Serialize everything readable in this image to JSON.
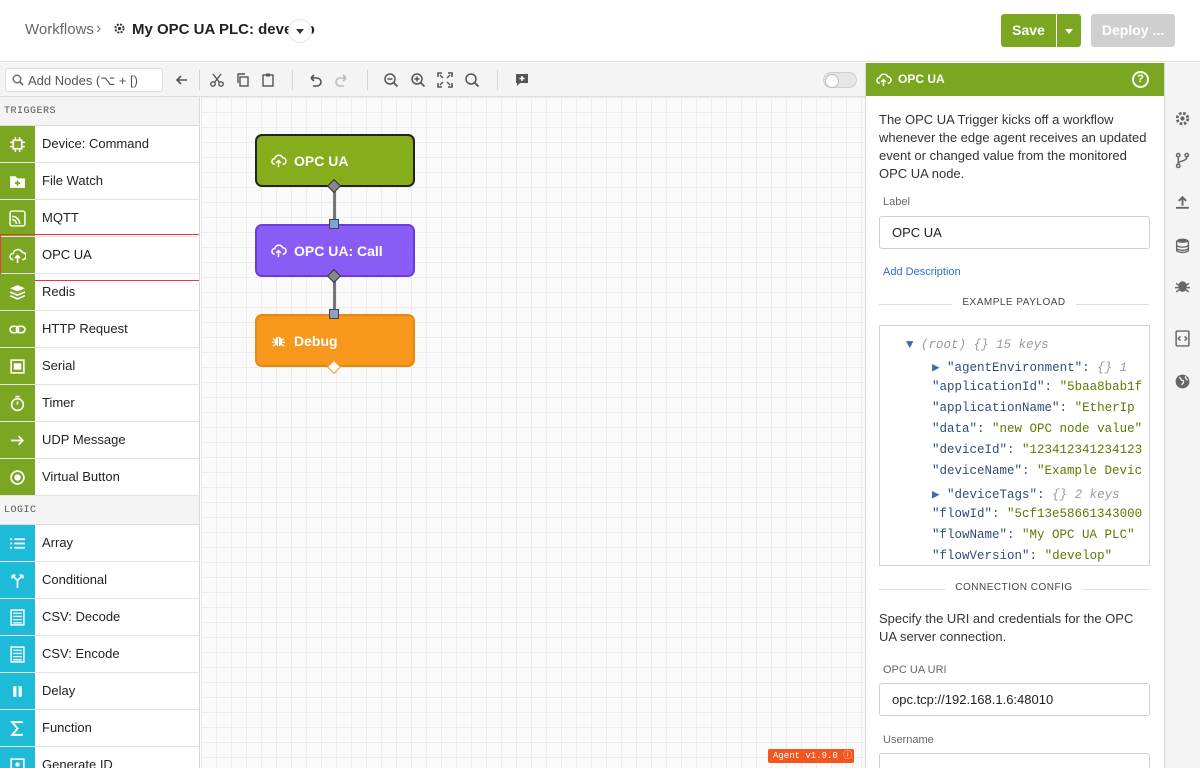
{
  "header": {
    "breadcrumb": "Workflows",
    "separator": "›",
    "flow_title": "My OPC UA PLC: develop",
    "save_label": "Save",
    "deploy_label": "Deploy ..."
  },
  "toolbar": {
    "search_placeholder": "Add Nodes (⌥ + [)"
  },
  "sidebar": {
    "triggers_heading": "TRIGGERS",
    "triggers": [
      {
        "label": "Device: Command",
        "icon": "chip-icon"
      },
      {
        "label": "File Watch",
        "icon": "folder-plus-icon"
      },
      {
        "label": "MQTT",
        "icon": "mqtt-icon"
      },
      {
        "label": "OPC UA",
        "icon": "cloud-upload-icon"
      },
      {
        "label": "Redis",
        "icon": "redis-layers-icon"
      },
      {
        "label": "HTTP Request",
        "icon": "link-icon"
      },
      {
        "label": "Serial",
        "icon": "serial-icon"
      },
      {
        "label": "Timer",
        "icon": "stopwatch-icon"
      },
      {
        "label": "UDP Message",
        "icon": "arrow-right-icon"
      },
      {
        "label": "Virtual Button",
        "icon": "radio-button-icon"
      }
    ],
    "logic_heading": "LOGIC",
    "logic": [
      {
        "label": "Array",
        "icon": "list-icon"
      },
      {
        "label": "Conditional",
        "icon": "branch-icon"
      },
      {
        "label": "CSV: Decode",
        "icon": "csv-icon"
      },
      {
        "label": "CSV: Encode",
        "icon": "csv-icon"
      },
      {
        "label": "Delay",
        "icon": "pause-icon"
      },
      {
        "label": "Function",
        "icon": "sigma-icon"
      },
      {
        "label": "Generate ID",
        "icon": "id-icon"
      }
    ]
  },
  "canvas": {
    "nodes": [
      {
        "label": "OPC UA",
        "color": "#86ad1c"
      },
      {
        "label": "OPC UA: Call",
        "color": "#8a5cf6"
      },
      {
        "label": "Debug",
        "color": "#f7981d"
      }
    ],
    "agent_badge": "Agent v1.9.0"
  },
  "panel": {
    "title": "OPC UA",
    "help": "?",
    "description": "The OPC UA Trigger kicks off a workflow whenever the edge agent receives an updated event or changed value from the monitored OPC UA node.",
    "label_caption": "Label",
    "label_value": "OPC UA",
    "add_description": "Add Description",
    "example_payload_heading": "EXAMPLE PAYLOAD",
    "payload": {
      "root": "(root)",
      "root_type": "{}",
      "root_count": "15 keys",
      "rows": [
        {
          "key": "\"agentEnvironment\"",
          "sep": ":",
          "value": "{}  1",
          "kind": "comment",
          "expandable": true
        },
        {
          "key": "\"applicationId\"",
          "sep": ":",
          "value": "\"5baa8bab1f",
          "kind": "string"
        },
        {
          "key": "\"applicationName\"",
          "sep": ":",
          "value": "\"EtherIp",
          "kind": "string"
        },
        {
          "key": "\"data\"",
          "sep": ":",
          "value": "\"new OPC node value\"",
          "kind": "string"
        },
        {
          "key": "\"deviceId\"",
          "sep": ":",
          "value": "\"123412341234123",
          "kind": "string"
        },
        {
          "key": "\"deviceName\"",
          "sep": ":",
          "value": "\"Example Devic",
          "kind": "string"
        },
        {
          "key": "\"deviceTags\"",
          "sep": ":",
          "value": "{}  2 keys",
          "kind": "comment",
          "expandable": true
        },
        {
          "key": "\"flowId\"",
          "sep": ":",
          "value": "\"5cf13e58661343000",
          "kind": "string"
        },
        {
          "key": "\"flowName\"",
          "sep": ":",
          "value": "\"My OPC UA PLC\"",
          "kind": "string"
        },
        {
          "key": "\"flowVersion\"",
          "sep": ":",
          "value": "\"develop\"",
          "kind": "string"
        }
      ]
    },
    "connection_heading": "CONNECTION CONFIG",
    "connection_description": "Specify the URI and credentials for the OPC UA server connection.",
    "uri_caption": "OPC UA URI",
    "uri_value": "opc.tcp://192.168.1.6:48010",
    "username_caption": "Username"
  },
  "rail": {
    "icons": [
      "gear-icon",
      "fork-icon",
      "upload-icon",
      "database-icon",
      "debug-icon",
      "code-icon",
      "globe-icon"
    ]
  },
  "colors": {
    "brand_green": "#7aa621",
    "logic_teal": "#1dbbd8",
    "call_purple": "#8a5cf6",
    "debug_orange": "#f7981d",
    "selection_red": "#e23b3b"
  }
}
